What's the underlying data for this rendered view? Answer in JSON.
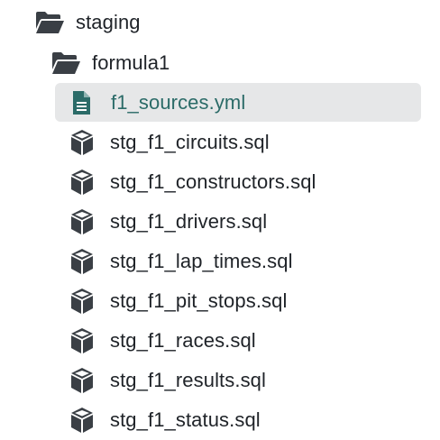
{
  "tree": {
    "root_folder": {
      "label": "staging",
      "icon": "folder-open-icon"
    },
    "sub_folder": {
      "label": "formula1",
      "icon": "folder-open-icon"
    },
    "selected_file": {
      "label": "f1_sources.yml",
      "icon": "yaml-file-icon"
    },
    "models": [
      {
        "label": "stg_f1_circuits.sql",
        "icon": "model-cube-icon"
      },
      {
        "label": "stg_f1_constructors.sql",
        "icon": "model-cube-icon"
      },
      {
        "label": "stg_f1_drivers.sql",
        "icon": "model-cube-icon"
      },
      {
        "label": "stg_f1_lap_times.sql",
        "icon": "model-cube-icon"
      },
      {
        "label": "stg_f1_pit_stops.sql",
        "icon": "model-cube-icon"
      },
      {
        "label": "stg_f1_races.sql",
        "icon": "model-cube-icon"
      },
      {
        "label": "stg_f1_results.sql",
        "icon": "model-cube-icon"
      },
      {
        "label": "stg_f1_status.sql",
        "icon": "model-cube-icon"
      }
    ]
  },
  "colors": {
    "text": "#1f2328",
    "icon": "#3a3f45",
    "selected_bg": "#e6e7e8",
    "selected_text": "#2b6b68"
  }
}
